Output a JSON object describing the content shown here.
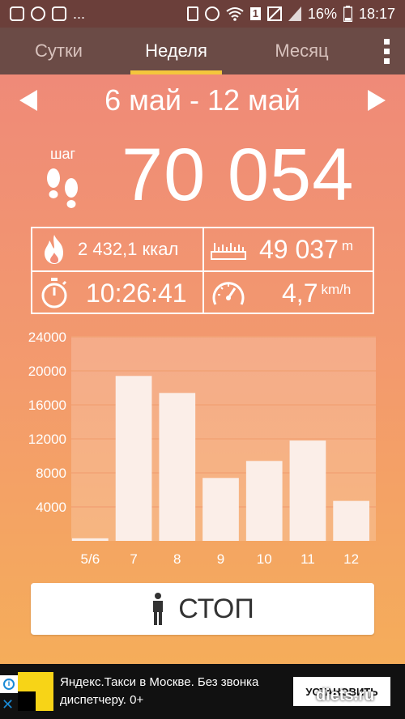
{
  "status": {
    "time": "18:17",
    "battery": "16%",
    "left_icons": [
      "flipboard-icon",
      "viber-icon",
      "instagram-icon"
    ],
    "overflow": "...",
    "right_icons": [
      "battery-saver-icon",
      "alarm-icon",
      "wifi-icon",
      "sim-badge-icon",
      "no-signal-icon",
      "signal-icon",
      "battery-icon"
    ],
    "sim_badge": "1"
  },
  "tabs": [
    {
      "label": "Сутки",
      "active": false
    },
    {
      "label": "Неделя",
      "active": true
    },
    {
      "label": "Месяц",
      "active": false
    }
  ],
  "date_range": "6 май - 12 май",
  "steps": {
    "label": "шаг",
    "value": "70 054"
  },
  "stats": {
    "calories": {
      "value": "2 432,1 ккал",
      "icon": "fire-icon"
    },
    "distance": {
      "value": "49 037",
      "unit": "m",
      "icon": "ruler-icon"
    },
    "duration": {
      "value": "10:26:41",
      "icon": "stopwatch-icon"
    },
    "speed": {
      "value": "4,7",
      "unit": "km/h",
      "icon": "speedometer-icon"
    }
  },
  "chart_data": {
    "type": "bar",
    "categories": [
      "5/6",
      "7",
      "8",
      "9",
      "10",
      "11",
      "12"
    ],
    "values": [
      300,
      19400,
      17400,
      7400,
      9400,
      11800,
      4700
    ],
    "yticks": [
      "24000",
      "20000",
      "16000",
      "12000",
      "8000",
      "4000"
    ],
    "ylim": [
      0,
      24000
    ],
    "grid": true,
    "colors": {
      "bar": "#fbeee8",
      "plot_bg": "rgba(255,240,235,0.22)",
      "grid": "#f2a275"
    }
  },
  "stop_button": {
    "label": "СТОП",
    "icon": "person-icon"
  },
  "ad": {
    "text": "Яндекс.Такси в Москве. Без звонка диспетчеру. 0+",
    "button": "УСТАНОВИТЬ",
    "watermark": "diets.ru",
    "close": "✕"
  }
}
